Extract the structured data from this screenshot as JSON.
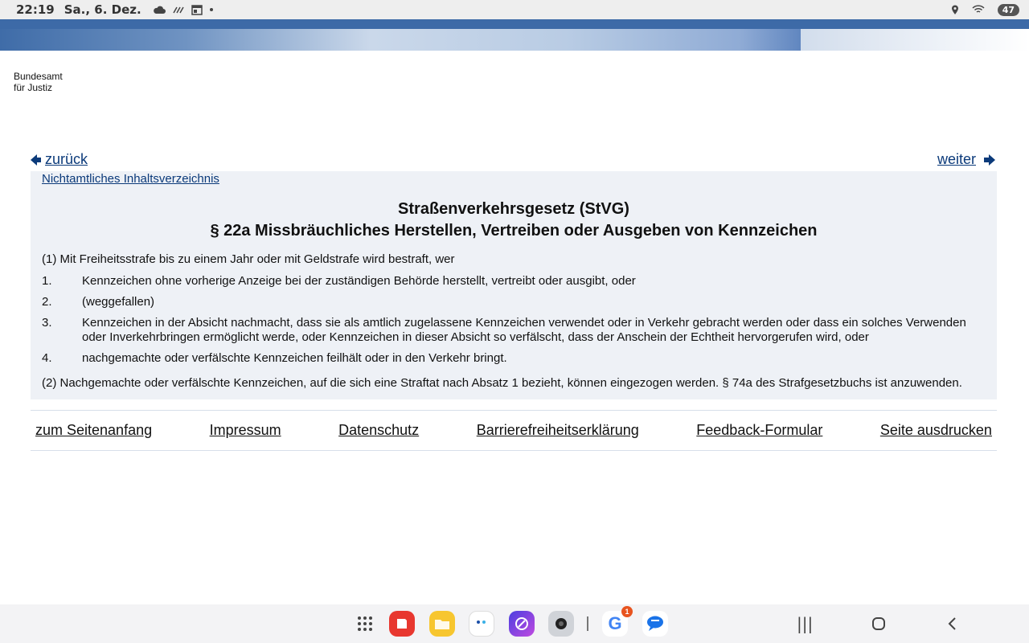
{
  "status_bar": {
    "time": "22:19",
    "date": "Sa., 6. Dez.",
    "battery": "47"
  },
  "logo": {
    "line1": "Bundesamt",
    "line2": "für Justiz"
  },
  "nav": {
    "back_label": "zurück",
    "next_label": "weiter"
  },
  "content": {
    "toc_link": "Nichtamtliches Inhaltsverzeichnis",
    "law_title": "Straßenverkehrsgesetz (StVG)",
    "section_title": "§ 22a Missbräuchliches Herstellen, Vertreiben oder Ausgeben von Kennzeichen",
    "para1": "(1) Mit Freiheitsstrafe bis zu einem Jahr oder mit Geldstrafe wird bestraft, wer",
    "items": [
      {
        "num": "1.",
        "text": "Kennzeichen ohne vorherige Anzeige bei der zuständigen Behörde herstellt, vertreibt oder ausgibt, oder"
      },
      {
        "num": "2.",
        "text": "(weggefallen)"
      },
      {
        "num": "3.",
        "text": "Kennzeichen in der Absicht nachmacht, dass sie als amtlich zugelassene Kennzeichen verwendet oder in Verkehr gebracht werden oder dass ein solches Verwenden oder Inverkehrbringen ermöglicht werde, oder Kennzeichen in dieser Absicht so verfälscht, dass der Anschein der Echtheit hervorgerufen wird, oder"
      },
      {
        "num": "4.",
        "text": "nachgemachte oder verfälschte Kennzeichen feilhält oder in den Verkehr bringt."
      }
    ],
    "para2": "(2) Nachgemachte oder verfälschte Kennzeichen, auf die sich eine Straftat nach Absatz 1 bezieht, können eingezogen werden. § 74a des Strafgesetzbuchs ist anzuwenden."
  },
  "footer": {
    "links": [
      "zum Seitenanfang",
      "Impressum",
      "Datenschutz",
      "Barrierefreiheitserklärung",
      "Feedback-Formular",
      "Seite ausdrucken"
    ]
  },
  "taskbar": {
    "google_badge": "1"
  },
  "colors": {
    "link_blue": "#0b3a7a",
    "header_blue": "#3d6aa7",
    "content_bg": "#eef1f6"
  }
}
